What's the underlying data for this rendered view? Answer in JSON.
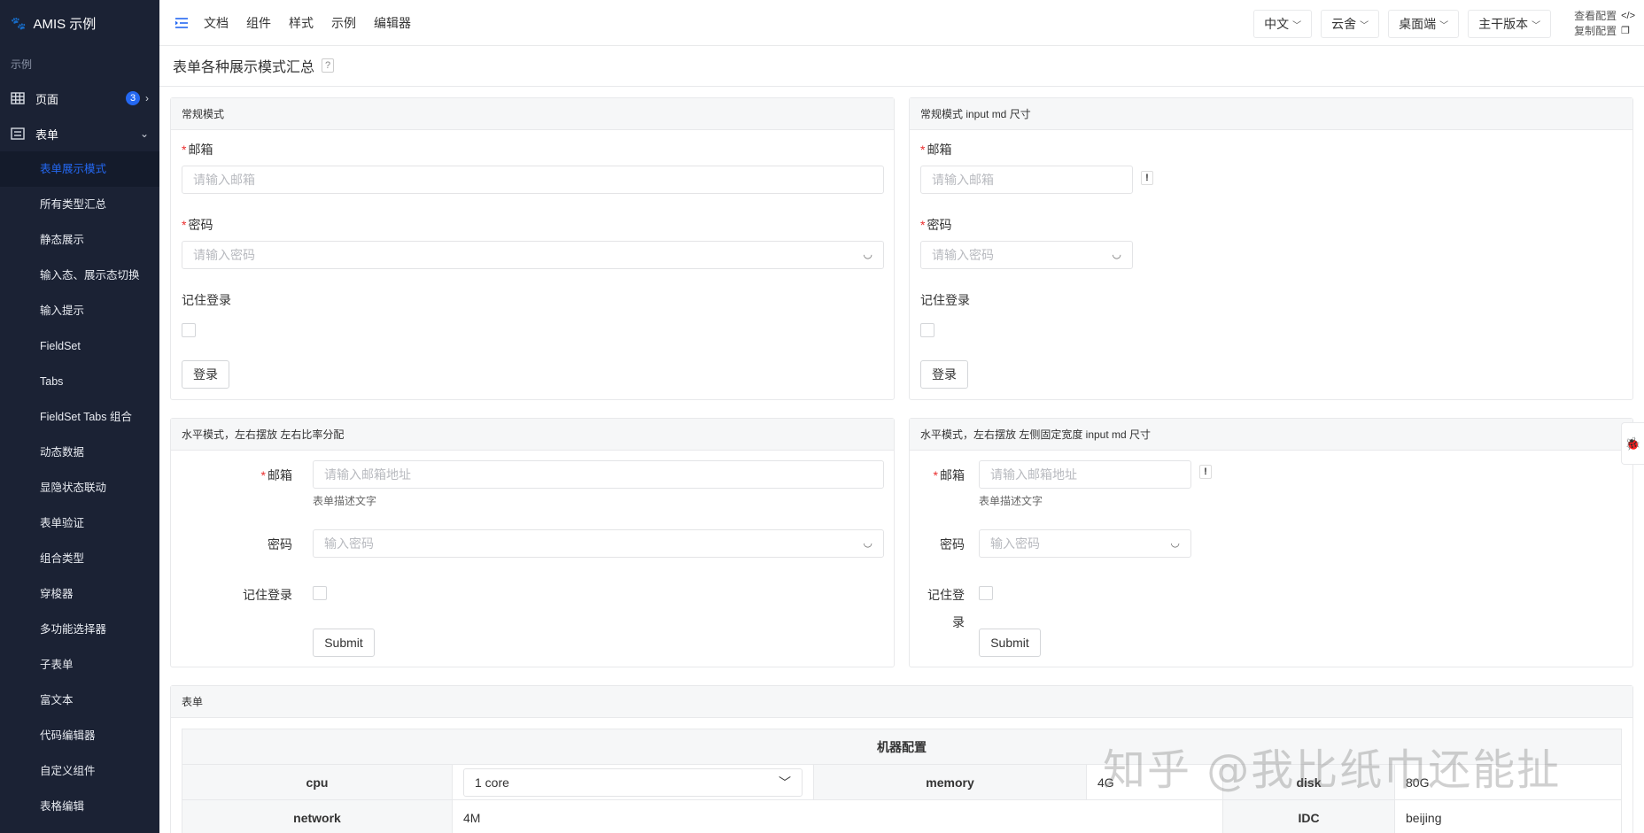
{
  "app": {
    "title": "AMIS 示例"
  },
  "sidebar": {
    "group_label": "示例",
    "top_items": [
      {
        "label": "页面",
        "badge": "3"
      },
      {
        "label": "表单"
      }
    ],
    "sub_items": [
      "表单展示模式",
      "所有类型汇总",
      "静态展示",
      "输入态、展示态切换",
      "输入提示",
      "FieldSet",
      "Tabs",
      "FieldSet Tabs 组合",
      "动态数据",
      "显隐状态联动",
      "表单验证",
      "组合类型",
      "穿梭器",
      "多功能选择器",
      "子表单",
      "富文本",
      "代码编辑器",
      "自定义组件",
      "表格编辑"
    ]
  },
  "topbar": {
    "nav": [
      "文档",
      "组件",
      "样式",
      "示例",
      "编辑器"
    ],
    "dropdowns": [
      "中文",
      "云舍",
      "桌面端",
      "主干版本"
    ],
    "view_config": "查看配置",
    "copy_config": "复制配置"
  },
  "page": {
    "title": "表单各种展示模式汇总",
    "help": "?"
  },
  "panel1": {
    "title": "常规模式",
    "email_label": "邮箱",
    "email_placeholder": "请输入邮箱",
    "password_label": "密码",
    "password_placeholder": "请输入密码",
    "remember_label": "记住登录",
    "submit": "登录"
  },
  "panel2": {
    "title": "常规模式 input md 尺寸",
    "email_label": "邮箱",
    "email_placeholder": "请输入邮箱",
    "password_label": "密码",
    "password_placeholder": "请输入密码",
    "remember_label": "记住登录",
    "submit": "登录",
    "remark": "!"
  },
  "panel3": {
    "title": "水平模式，左右摆放 左右比率分配",
    "email_label": "邮箱",
    "email_placeholder": "请输入邮箱地址",
    "email_desc": "表单描述文字",
    "password_label": "密码",
    "password_placeholder": "输入密码",
    "remember_label": "记住登录",
    "submit": "Submit"
  },
  "panel4": {
    "title": "水平模式，左右摆放 左侧固定宽度 input md 尺寸",
    "email_label": "邮箱",
    "email_placeholder": "请输入邮箱地址",
    "email_desc": "表单描述文字",
    "password_label": "密码",
    "password_placeholder": "输入密码",
    "remember_label_1": "记住登",
    "remember_label_2": "录",
    "submit": "Submit",
    "remark": "!"
  },
  "panel5": {
    "title": "表单",
    "table_header": "机器配置",
    "row1": {
      "cpu_label": "cpu",
      "cpu_value": "1 core",
      "memory_label": "memory",
      "memory_value": "4G",
      "disk_label": "disk",
      "disk_value": "80G"
    },
    "row2": {
      "network_label": "network",
      "network_value": "4M",
      "idc_label": "IDC",
      "idc_value": "beijing"
    }
  },
  "watermark": "知乎 @我比纸巾还能扯",
  "colors": {
    "sidebar_bg": "#1b2234",
    "accent": "#2468f2",
    "required": "#ea2e2e"
  }
}
